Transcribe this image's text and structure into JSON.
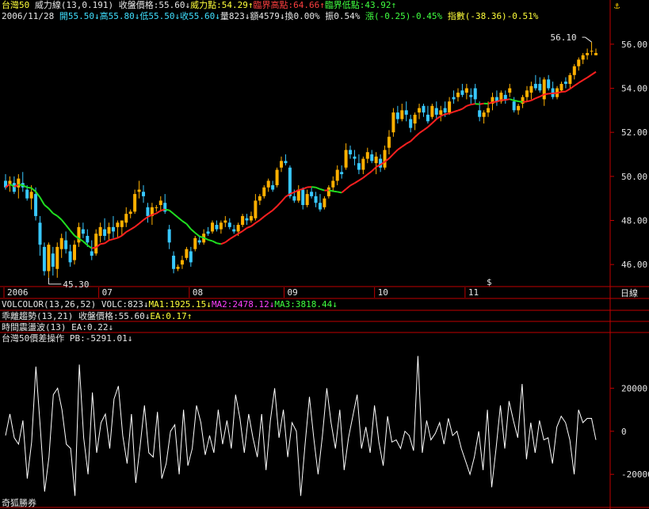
{
  "header": {
    "line1": {
      "name": "台灣50",
      "indicator": "威力線(13,0.191)",
      "close_label": "收盤價格:55.60↓",
      "power_label": "威力點:54.29↑",
      "crit_high_label": "臨界高點:64.66↑",
      "crit_low_label": "臨界低點:43.92↑"
    },
    "line2": {
      "date": "2006/11/28",
      "open": "開55.50↓",
      "high": "高55.80↓",
      "low": "低55.50↓",
      "close": "收55.60↓",
      "vol": "量823↓",
      "amount": "額4579↓",
      "turnover": "換0.00%",
      "amplitude": "振0.54%",
      "change": "漲(-0.25)-0.45%",
      "index_change": "指數(-38.36)-0.51%"
    }
  },
  "panels": {
    "volcolor": {
      "label": "VOLCOLOR(13,26,52)",
      "volc": "VOLC:823↓",
      "ma1": "MA1:1925.15↓",
      "ma2": "MA2:2478.12↓",
      "ma3": "MA3:3818.44↓"
    },
    "deviation": {
      "label": "乖離趨勢(13,21) 收盤價格:55.60↓",
      "ea": "EA:0.17↑"
    },
    "time_osc": {
      "label": "時間震盪波(13) EA:0.22↓"
    },
    "price_diff": {
      "label": "台灣50價差操作 PB:-5291.01↓"
    }
  },
  "axis_right_main": [
    "56.00",
    "54.00",
    "52.00",
    "50.00",
    "48.00",
    "46.00"
  ],
  "axis_right_lower": [
    "20000",
    "0",
    "-20000"
  ],
  "month_labels": [
    "2006",
    "07",
    "08",
    "09",
    "10",
    "11"
  ],
  "axis_unit": "日線",
  "annotations": {
    "max": "56.10",
    "min": "45.30",
    "marker": "$"
  },
  "brand": "奇狐勝券",
  "colors": {
    "up": "#ffb000",
    "down": "#38c8ff",
    "ma_up": "#ff2020",
    "ma_down": "#20e020",
    "osc": "#ffffff"
  },
  "chart_data": {
    "type": "candlestick",
    "candles_ohlc": [
      [
        49.8,
        50.1,
        49.4,
        49.5
      ],
      [
        49.6,
        50.0,
        49.3,
        49.8
      ],
      [
        49.7,
        50.0,
        49.2,
        49.3
      ],
      [
        49.5,
        50.1,
        49.0,
        49.9
      ],
      [
        49.7,
        50.2,
        49.3,
        49.5
      ],
      [
        49.4,
        49.6,
        48.9,
        49.0
      ],
      [
        49.0,
        49.6,
        48.5,
        49.3
      ],
      [
        49.2,
        49.5,
        48.0,
        48.2
      ],
      [
        47.9,
        48.2,
        46.4,
        46.9
      ],
      [
        46.8,
        47.0,
        45.5,
        45.7
      ],
      [
        45.7,
        47.0,
        45.4,
        46.9
      ],
      [
        46.5,
        46.8,
        45.5,
        45.9
      ],
      [
        45.8,
        47.0,
        45.4,
        46.8
      ],
      [
        46.7,
        47.4,
        46.3,
        47.2
      ],
      [
        47.1,
        47.5,
        46.5,
        46.7
      ],
      [
        46.6,
        46.9,
        45.9,
        46.1
      ],
      [
        46.2,
        47.1,
        46.0,
        46.9
      ],
      [
        47.0,
        47.9,
        46.8,
        47.7
      ],
      [
        47.6,
        47.9,
        47.2,
        47.4
      ],
      [
        47.3,
        47.6,
        46.8,
        47.0
      ],
      [
        46.6,
        47.1,
        46.2,
        46.4
      ],
      [
        46.5,
        47.6,
        46.4,
        47.4
      ],
      [
        47.3,
        47.9,
        47.0,
        47.7
      ],
      [
        47.6,
        48.1,
        47.1,
        47.3
      ],
      [
        47.4,
        47.9,
        47.1,
        47.7
      ],
      [
        47.7,
        48.2,
        47.2,
        47.5
      ],
      [
        47.7,
        48.0,
        47.2,
        47.9
      ],
      [
        47.7,
        48.0,
        47.3,
        48.0
      ],
      [
        47.9,
        48.6,
        47.7,
        48.3
      ],
      [
        48.3,
        48.5,
        48.1,
        48.4
      ],
      [
        48.4,
        49.4,
        48.3,
        49.2
      ],
      [
        49.3,
        49.8,
        49.0,
        49.4
      ],
      [
        49.3,
        49.6,
        48.8,
        49.1
      ],
      [
        48.6,
        48.8,
        47.9,
        48.2
      ],
      [
        48.2,
        48.8,
        47.8,
        48.6
      ],
      [
        48.6,
        48.7,
        48.4,
        48.6
      ],
      [
        48.7,
        49.1,
        48.4,
        48.9
      ],
      [
        48.8,
        49.2,
        48.3,
        48.4
      ],
      [
        47.6,
        47.8,
        46.7,
        47.0
      ],
      [
        46.4,
        46.6,
        45.6,
        45.8
      ],
      [
        45.8,
        46.0,
        45.7,
        45.9
      ],
      [
        46.0,
        46.4,
        45.8,
        46.2
      ],
      [
        46.3,
        46.8,
        46.2,
        46.7
      ],
      [
        46.6,
        46.8,
        45.9,
        46.1
      ],
      [
        46.7,
        47.3,
        46.6,
        47.2
      ],
      [
        47.1,
        47.3,
        46.9,
        47.0
      ],
      [
        47.0,
        47.6,
        46.9,
        47.4
      ],
      [
        47.5,
        47.7,
        47.3,
        47.4
      ],
      [
        47.5,
        48.0,
        47.4,
        47.9
      ],
      [
        47.8,
        48.0,
        47.5,
        47.6
      ],
      [
        47.6,
        48.0,
        47.4,
        47.9
      ],
      [
        47.9,
        48.2,
        47.7,
        48.0
      ],
      [
        47.9,
        48.1,
        47.6,
        47.7
      ],
      [
        47.6,
        47.8,
        47.4,
        47.5
      ],
      [
        47.5,
        47.9,
        47.3,
        47.8
      ],
      [
        47.8,
        48.3,
        47.7,
        48.2
      ],
      [
        48.1,
        48.3,
        47.8,
        48.0
      ],
      [
        48.0,
        48.4,
        47.9,
        48.2
      ],
      [
        48.1,
        49.2,
        48.0,
        48.9
      ],
      [
        48.9,
        49.2,
        48.7,
        49.1
      ],
      [
        49.1,
        49.6,
        49.0,
        49.5
      ],
      [
        49.5,
        49.9,
        49.3,
        49.8
      ],
      [
        49.6,
        49.8,
        49.3,
        49.4
      ],
      [
        49.6,
        50.4,
        49.5,
        50.3
      ],
      [
        50.4,
        50.9,
        50.2,
        50.7
      ],
      [
        50.7,
        51.0,
        50.5,
        50.6
      ],
      [
        50.4,
        50.5,
        49.0,
        49.1
      ],
      [
        49.1,
        49.4,
        48.8,
        48.9
      ],
      [
        48.9,
        49.6,
        48.8,
        49.4
      ],
      [
        49.4,
        49.5,
        48.5,
        48.7
      ],
      [
        48.7,
        49.4,
        48.6,
        49.2
      ],
      [
        49.3,
        49.5,
        49.0,
        49.1
      ],
      [
        49.1,
        49.3,
        48.6,
        48.8
      ],
      [
        48.8,
        49.2,
        48.4,
        48.5
      ],
      [
        48.6,
        49.1,
        48.5,
        49.0
      ],
      [
        49.1,
        49.6,
        49.0,
        49.5
      ],
      [
        49.5,
        50.0,
        49.3,
        49.8
      ],
      [
        49.8,
        50.5,
        49.6,
        50.3
      ],
      [
        50.2,
        50.5,
        49.9,
        50.1
      ],
      [
        50.4,
        51.5,
        50.3,
        51.2
      ],
      [
        51.2,
        51.4,
        50.8,
        51.0
      ],
      [
        50.9,
        51.2,
        50.5,
        50.8
      ],
      [
        50.6,
        51.0,
        50.1,
        50.3
      ],
      [
        50.3,
        50.9,
        50.1,
        50.8
      ],
      [
        50.8,
        51.3,
        50.6,
        51.1
      ],
      [
        51.0,
        51.2,
        50.6,
        50.7
      ],
      [
        50.6,
        51.1,
        50.1,
        50.9
      ],
      [
        50.8,
        51.0,
        50.2,
        50.4
      ],
      [
        50.4,
        51.4,
        50.3,
        51.2
      ],
      [
        51.3,
        52.1,
        51.0,
        51.8
      ],
      [
        52.0,
        53.1,
        51.8,
        52.9
      ],
      [
        52.9,
        53.2,
        52.4,
        52.6
      ],
      [
        52.6,
        53.3,
        52.5,
        53.0
      ],
      [
        53.0,
        53.4,
        52.5,
        52.8
      ],
      [
        52.6,
        52.8,
        52.0,
        52.2
      ],
      [
        52.4,
        52.9,
        52.1,
        52.8
      ],
      [
        52.9,
        53.3,
        52.6,
        53.1
      ],
      [
        53.2,
        53.3,
        52.7,
        52.9
      ],
      [
        52.8,
        53.2,
        52.4,
        52.5
      ],
      [
        52.7,
        53.3,
        52.6,
        53.2
      ],
      [
        53.1,
        53.4,
        52.6,
        52.8
      ],
      [
        52.8,
        53.2,
        52.5,
        53.0
      ],
      [
        53.1,
        53.4,
        52.7,
        52.9
      ],
      [
        52.9,
        53.6,
        52.8,
        53.4
      ],
      [
        53.6,
        53.9,
        53.3,
        53.5
      ],
      [
        53.6,
        54.0,
        53.4,
        53.8
      ],
      [
        53.9,
        54.2,
        53.6,
        53.7
      ],
      [
        53.8,
        54.2,
        53.5,
        54.0
      ],
      [
        53.7,
        54.0,
        53.3,
        53.6
      ],
      [
        54.0,
        54.2,
        53.3,
        53.5
      ],
      [
        53.0,
        53.4,
        52.5,
        52.7
      ],
      [
        52.7,
        53.0,
        52.4,
        52.9
      ],
      [
        52.9,
        53.4,
        52.7,
        53.1
      ],
      [
        53.3,
        53.8,
        53.0,
        53.6
      ],
      [
        53.6,
        53.9,
        53.2,
        53.4
      ],
      [
        53.4,
        53.9,
        53.3,
        53.8
      ],
      [
        53.7,
        53.9,
        53.3,
        53.5
      ],
      [
        53.8,
        54.2,
        53.6,
        54.0
      ],
      [
        53.4,
        53.6,
        52.9,
        53.0
      ],
      [
        53.0,
        53.3,
        52.8,
        53.2
      ],
      [
        53.3,
        53.7,
        53.1,
        53.6
      ],
      [
        53.6,
        54.1,
        53.4,
        53.9
      ],
      [
        53.8,
        54.3,
        53.5,
        54.1
      ],
      [
        54.2,
        54.6,
        53.9,
        54.0
      ],
      [
        54.2,
        54.5,
        53.8,
        53.9
      ],
      [
        53.5,
        54.5,
        53.2,
        54.4
      ],
      [
        54.4,
        54.6,
        53.9,
        54.0
      ],
      [
        54.0,
        54.3,
        53.5,
        53.6
      ],
      [
        53.6,
        54.1,
        53.5,
        54.0
      ],
      [
        53.9,
        54.3,
        53.8,
        54.2
      ],
      [
        54.3,
        54.5,
        54.0,
        54.2
      ],
      [
        54.2,
        54.7,
        54.0,
        54.6
      ],
      [
        54.6,
        55.1,
        54.4,
        55.0
      ],
      [
        55.0,
        55.4,
        54.8,
        55.3
      ],
      [
        55.3,
        55.6,
        55.1,
        55.5
      ],
      [
        55.5,
        55.8,
        55.3,
        55.6
      ],
      [
        55.7,
        56.1,
        55.5,
        55.7
      ],
      [
        55.5,
        55.8,
        55.5,
        55.6
      ]
    ],
    "osc_values": [
      -2000,
      8000,
      -3000,
      -6000,
      5000,
      -22000,
      -5000,
      30000,
      2000,
      -28000,
      -12000,
      17000,
      20000,
      10000,
      -6000,
      -8000,
      -30000,
      31000,
      -3000,
      -20000,
      18000,
      -10000,
      4000,
      8000,
      -8000,
      15000,
      21000,
      -2000,
      -15000,
      8000,
      -24000,
      -7000,
      12000,
      -10000,
      -12000,
      9000,
      -22000,
      -15000,
      0,
      3000,
      -20000,
      10000,
      -16000,
      -8000,
      12000,
      4000,
      -11000,
      -2000,
      -10000,
      10000,
      -6000,
      5000,
      -8000,
      17000,
      6000,
      -10000,
      8000,
      -3000,
      -12000,
      8000,
      -18000,
      5000,
      20000,
      -3000,
      10000,
      -12000,
      4000,
      0,
      -30000,
      -6000,
      16000,
      -3000,
      -20000,
      -2000,
      20000,
      4000,
      -8000,
      10000,
      -18000,
      -3000,
      7000,
      17000,
      -8000,
      2000,
      -10000,
      12000,
      -5000,
      -16000,
      7000,
      -5000,
      -4000,
      -8000,
      0,
      -2000,
      -9000,
      35000,
      -10000,
      5000,
      -4000,
      -1000,
      4000,
      -6000,
      6000,
      -2000,
      0,
      -8000,
      -14000,
      -20000,
      -12000,
      0,
      -18000,
      10000,
      -26000,
      -8000,
      12000,
      -8000,
      14000,
      5000,
      -3000,
      22000,
      -13000,
      4000,
      -10000,
      5000,
      -4000,
      -3000,
      -15000,
      2000,
      7000,
      4000,
      -4000,
      -20000,
      10000,
      4000,
      6000,
      6000,
      -4000
    ],
    "ylim_main": [
      45.0,
      57.0
    ],
    "ylim_osc": [
      -35000,
      40000
    ],
    "bars_per_month": [
      22,
      21,
      22,
      21,
      21,
      19
    ]
  }
}
